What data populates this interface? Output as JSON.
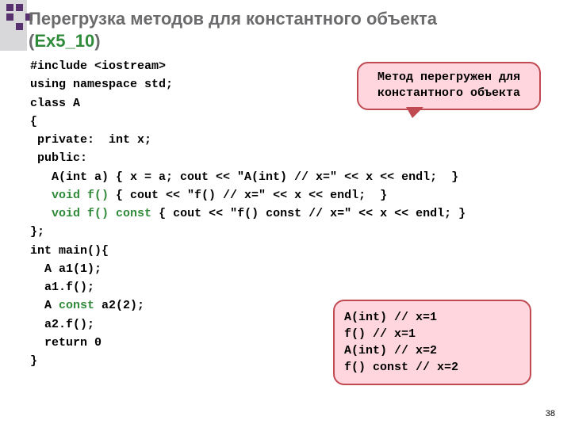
{
  "title": {
    "main": "Перегрузка методов для константного объекта",
    "open": "(",
    "ex": "Ex5_10",
    "close": ")"
  },
  "callout": {
    "text": "Метод перегружен для константного объекта"
  },
  "code": {
    "l1": "#include <iostream>",
    "l2": "using namespace std;",
    "l3": "class A",
    "l4": "{",
    "l5": " private:  int x;",
    "l6": " public:",
    "l7": "   A(int a) { x = a; cout << \"A(int) // x=\" << x << endl;  }",
    "l8a": "   ",
    "kw8": "void f()",
    "l8b": " { cout << \"f() // x=\" << x << endl;  }",
    "l9a": "   ",
    "kw9a": "void f()",
    "l9b": " ",
    "kw9b": "const",
    "l9c": " { cout << \"f() const // x=\" << x << endl; }",
    "l10": "};",
    "l11": "int main(){",
    "l12": "  A a1(1);",
    "l13": "  a1.f();",
    "l14a": "  A ",
    "kw14": "const",
    "l14b": " a2(2);",
    "l15": "  a2.f();",
    "l16": "  return 0",
    "l17": "}"
  },
  "output": {
    "o1": "A(int) // x=1",
    "o2": "f() // x=1",
    "o3": "A(int) // x=2",
    "o4": "f() const // x=2"
  },
  "page": "38"
}
